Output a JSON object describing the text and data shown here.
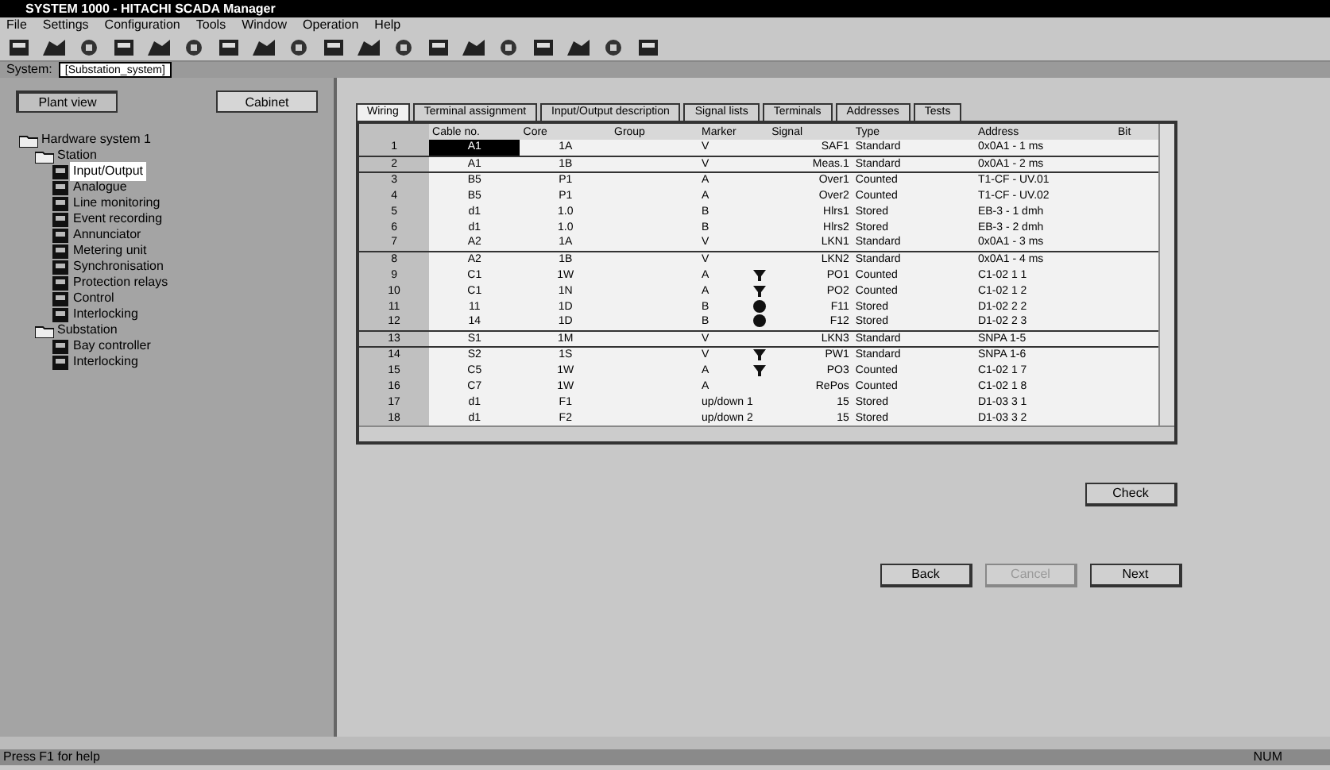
{
  "window": {
    "title": "SYSTEM 1000 - HITACHI SCADA Manager"
  },
  "menu": [
    "File",
    "Settings",
    "Configuration",
    "Tools",
    "Window",
    "Operation",
    "Help"
  ],
  "system_bar": {
    "label": "System:",
    "value": "[Substation_system]"
  },
  "view_buttons": [
    {
      "label": "Plant view",
      "selected": true
    },
    {
      "label": "Cabinet",
      "selected": false
    }
  ],
  "tree": [
    {
      "label": "Hardware system 1",
      "expanded": true,
      "children": [
        {
          "label": "Station",
          "expanded": true,
          "children": [
            {
              "label": "Input/Output",
              "selected": true
            },
            {
              "label": "Analogue",
              "selected": false
            },
            {
              "label": "Line monitoring",
              "selected": false
            },
            {
              "label": "Event recording",
              "selected": false
            },
            {
              "label": "Annunciator",
              "selected": false
            },
            {
              "label": "Metering unit",
              "selected": false
            },
            {
              "label": "Synchronisation",
              "selected": false
            },
            {
              "label": "Protection relays",
              "selected": false
            },
            {
              "label": "Control",
              "selected": false
            },
            {
              "label": "Interlocking",
              "selected": false
            }
          ]
        },
        {
          "label": "Substation",
          "expanded": true,
          "children": [
            {
              "label": "Bay controller",
              "selected": false
            },
            {
              "label": "Interlocking",
              "selected": false
            }
          ]
        }
      ]
    }
  ],
  "tabs": [
    {
      "label": "Wiring",
      "selected": true
    },
    {
      "label": "Terminal assignment",
      "selected": false
    },
    {
      "label": "Input/Output description",
      "selected": false
    },
    {
      "label": "Signal lists",
      "selected": false
    },
    {
      "label": "Terminals",
      "selected": false
    },
    {
      "label": "Addresses",
      "selected": false
    },
    {
      "label": "Tests",
      "selected": false
    }
  ],
  "table": {
    "columns": [
      "Cable no.",
      "Core",
      "Group",
      "Marker",
      "Signal",
      "Type",
      "Address",
      "Bit"
    ],
    "rows": [
      {
        "n": "1",
        "cells": [
          "A1",
          "1A",
          "",
          "V",
          "SAF1",
          "Standard",
          "0x0A1 - 1 ms",
          ""
        ],
        "kind": "plain",
        "group_end": true,
        "selected": true
      },
      {
        "n": "2",
        "cells": [
          "A1",
          "1B",
          "",
          "V",
          "Meas.1",
          "Standard",
          "0x0A1 - 2 ms",
          ""
        ],
        "kind": "plain",
        "group_end": true,
        "selected": false
      },
      {
        "n": "3",
        "cells": [
          "B5",
          "P1",
          "",
          "A",
          "Over1",
          "Counted",
          "T1-CF - UV.01",
          ""
        ],
        "kind": "plain",
        "group_end": false,
        "selected": false
      },
      {
        "n": "4",
        "cells": [
          "B5",
          "P1",
          "",
          "A",
          "Over2",
          "Counted",
          "T1-CF - UV.02",
          ""
        ],
        "kind": "plain",
        "group_end": false,
        "selected": false
      },
      {
        "n": "5",
        "cells": [
          "d1",
          "1.0",
          "",
          "B",
          "Hlrs1",
          "Stored",
          "EB-3 - 1 dmh",
          ""
        ],
        "kind": "plain",
        "group_end": false,
        "selected": false
      },
      {
        "n": "6",
        "cells": [
          "d1",
          "1.0",
          "",
          "B",
          "Hlrs2",
          "Stored",
          "EB-3 - 2 dmh",
          ""
        ],
        "kind": "plain",
        "group_end": false,
        "selected": false
      },
      {
        "n": "7",
        "cells": [
          "A2",
          "1A",
          "",
          "V",
          "LKN1",
          "Standard",
          "0x0A1 - 3 ms",
          ""
        ],
        "kind": "plain",
        "group_end": true,
        "selected": false
      },
      {
        "n": "8",
        "cells": [
          "A2",
          "1B",
          "",
          "V",
          "LKN2",
          "Standard",
          "0x0A1 - 4 ms",
          ""
        ],
        "kind": "plain",
        "group_end": false,
        "selected": false
      },
      {
        "n": "9",
        "cells": [
          "C1",
          "1W",
          "",
          "A",
          "PO1",
          "Counted",
          "C1-02 1 1",
          ""
        ],
        "kind": "funnel",
        "group_end": false,
        "selected": false
      },
      {
        "n": "10",
        "cells": [
          "C1",
          "1N",
          "",
          "A",
          "PO2",
          "Counted",
          "C1-02 1 2",
          ""
        ],
        "kind": "funnel",
        "group_end": false,
        "selected": false
      },
      {
        "n": "11",
        "cells": [
          "11",
          "1D",
          "",
          "B",
          "F11",
          "Stored",
          "D1-02 2 2",
          ""
        ],
        "kind": "dot",
        "group_end": false,
        "selected": false
      },
      {
        "n": "12",
        "cells": [
          "14",
          "1D",
          "",
          "B",
          "F12",
          "Stored",
          "D1-02 2 3",
          ""
        ],
        "kind": "dot",
        "group_end": true,
        "selected": false
      },
      {
        "n": "13",
        "cells": [
          "S1",
          "1M",
          "",
          "V",
          "LKN3",
          "Standard",
          "SNPA 1-5",
          ""
        ],
        "kind": "plain",
        "group_end": true,
        "selected": false
      },
      {
        "n": "14",
        "cells": [
          "S2",
          "1S",
          "",
          "V",
          "PW1",
          "Standard",
          "SNPA 1-6",
          ""
        ],
        "kind": "funnel",
        "group_end": false,
        "selected": false
      },
      {
        "n": "15",
        "cells": [
          "C5",
          "1W",
          "",
          "A",
          "PO3",
          "Counted",
          "C1-02 1 7",
          ""
        ],
        "kind": "funnel",
        "group_end": false,
        "selected": false
      },
      {
        "n": "16",
        "cells": [
          "C7",
          "1W",
          "",
          "A",
          "RePos",
          "Counted",
          "C1-02 1 8",
          ""
        ],
        "kind": "plain",
        "group_end": false,
        "selected": false
      },
      {
        "n": "17",
        "cells": [
          "d1",
          "F1",
          "",
          "up/down 1",
          "15",
          "Stored",
          "D1-03 3 1",
          ""
        ],
        "kind": "plain",
        "group_end": false,
        "selected": false
      },
      {
        "n": "18",
        "cells": [
          "d1",
          "F2",
          "",
          "up/down 2",
          "15",
          "Stored",
          "D1-03 3 2",
          ""
        ],
        "kind": "plain",
        "group_end": false,
        "selected": false
      }
    ]
  },
  "check_button": "Check",
  "nav_buttons": [
    {
      "label": "Back",
      "disabled": false
    },
    {
      "label": "Cancel",
      "disabled": true
    },
    {
      "label": "Next",
      "disabled": false
    }
  ],
  "status_bar": {
    "text": "Press F1 for help",
    "mode": "NUM"
  }
}
